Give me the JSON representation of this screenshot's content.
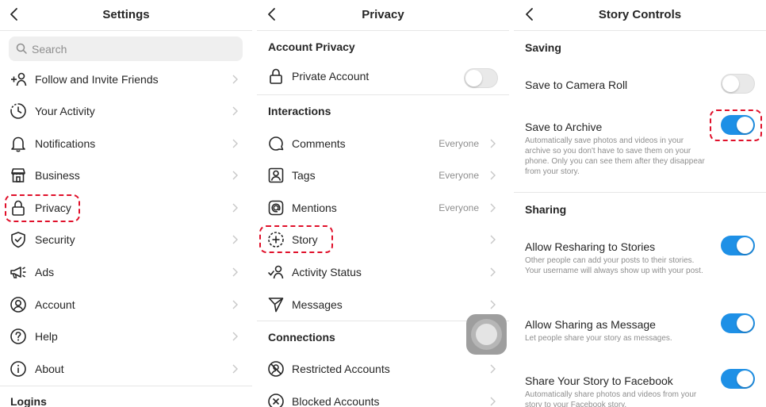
{
  "settings": {
    "title": "Settings",
    "search_placeholder": "Search",
    "items": [
      {
        "label": "Follow and Invite Friends",
        "icon": "add-person-icon"
      },
      {
        "label": "Your Activity",
        "icon": "activity-icon"
      },
      {
        "label": "Notifications",
        "icon": "bell-icon"
      },
      {
        "label": "Business",
        "icon": "shop-icon"
      },
      {
        "label": "Privacy",
        "icon": "lock-icon"
      },
      {
        "label": "Security",
        "icon": "shield-icon"
      },
      {
        "label": "Ads",
        "icon": "megaphone-icon"
      },
      {
        "label": "Account",
        "icon": "account-icon"
      },
      {
        "label": "Help",
        "icon": "help-icon"
      },
      {
        "label": "About",
        "icon": "info-icon"
      }
    ],
    "logins_heading": "Logins"
  },
  "privacy": {
    "title": "Privacy",
    "account_privacy_heading": "Account Privacy",
    "private_account": {
      "label": "Private Account",
      "enabled": false
    },
    "interactions_heading": "Interactions",
    "interactions": [
      {
        "label": "Comments",
        "value": "Everyone",
        "icon": "comment-icon"
      },
      {
        "label": "Tags",
        "value": "Everyone",
        "icon": "tag-person-icon"
      },
      {
        "label": "Mentions",
        "value": "Everyone",
        "icon": "at-sign-icon"
      },
      {
        "label": "Story",
        "value": "",
        "icon": "story-add-icon"
      },
      {
        "label": "Activity Status",
        "value": "",
        "icon": "activity-status-icon"
      },
      {
        "label": "Messages",
        "value": "",
        "icon": "send-icon"
      }
    ],
    "connections_heading": "Connections",
    "connections": [
      {
        "label": "Restricted Accounts",
        "icon": "restricted-icon"
      },
      {
        "label": "Blocked Accounts",
        "icon": "blocked-icon"
      }
    ]
  },
  "story_controls": {
    "title": "Story Controls",
    "saving_heading": "Saving",
    "save_camera_roll": {
      "label": "Save to Camera Roll",
      "enabled": false
    },
    "save_archive": {
      "label": "Save to Archive",
      "desc": "Automatically save photos and videos in your archive so you don't have to save them on your phone. Only you can see them after they disappear from your story.",
      "enabled": true
    },
    "sharing_heading": "Sharing",
    "allow_resharing": {
      "label": "Allow Resharing to Stories",
      "desc": "Other people can add your posts to their stories. Your username will always show up with your post.",
      "enabled": true
    },
    "allow_message": {
      "label": "Allow Sharing as Message",
      "desc": "Let people share your story as messages.",
      "enabled": true
    },
    "share_facebook": {
      "label": "Share Your Story to Facebook",
      "desc": "Automatically share photos and videos from your story to your Facebook story.",
      "enabled": true
    }
  },
  "colors": {
    "toggle_on": "#1e90e6",
    "highlight": "#e0102a",
    "text": "#262626",
    "secondary": "#8e8e8e"
  }
}
